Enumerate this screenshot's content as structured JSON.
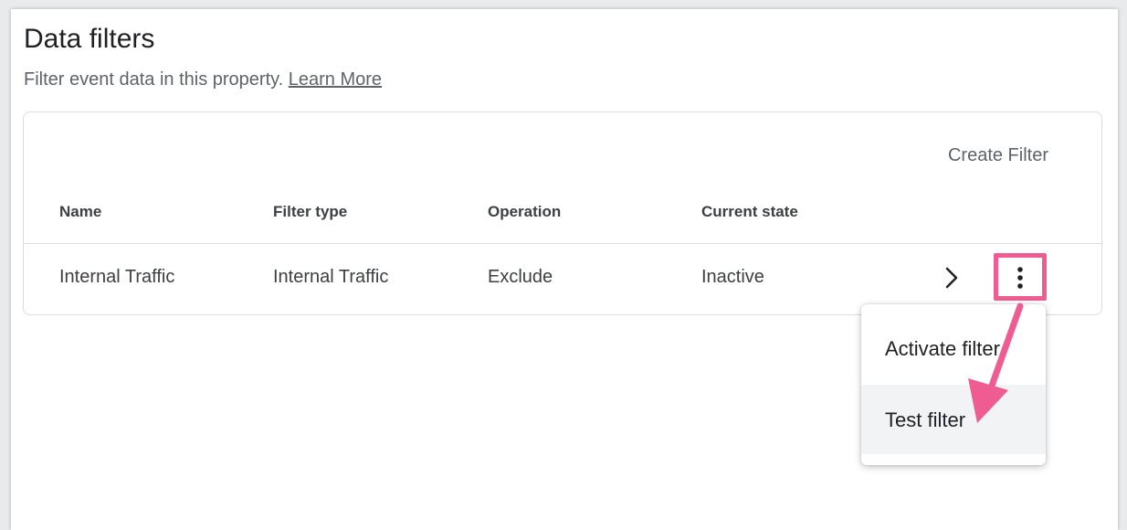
{
  "page": {
    "title": "Data filters",
    "description": "Filter event data in this property.",
    "learn_more": "Learn More"
  },
  "table": {
    "create_filter_label": "Create Filter",
    "columns": [
      "Name",
      "Filter type",
      "Operation",
      "Current state"
    ],
    "rows": [
      {
        "name": "Internal Traffic",
        "filter_type": "Internal Traffic",
        "operation": "Exclude",
        "current_state": "Inactive"
      }
    ]
  },
  "menu": {
    "items": [
      "Activate filter",
      "Test filter"
    ]
  },
  "icons": {
    "row_open": "chevron-right-icon",
    "row_more": "more-vert-icon",
    "annotation": "pointer-arrow"
  },
  "colors": {
    "highlight": "#ee5c91",
    "text_primary": "#202124",
    "text_secondary": "#5f6368",
    "border": "#dadce0",
    "hover_bg": "#f1f3f4"
  }
}
